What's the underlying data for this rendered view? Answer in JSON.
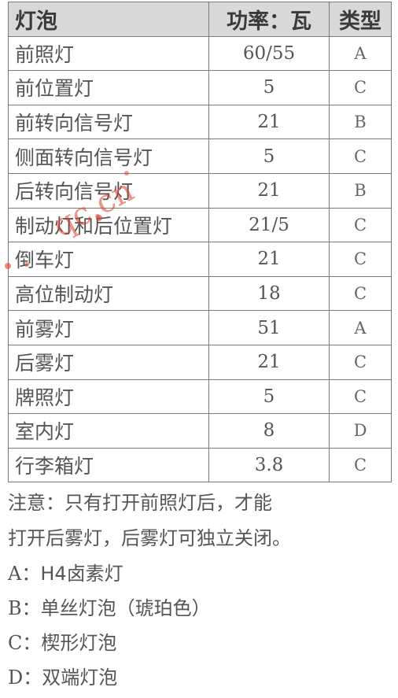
{
  "table": {
    "headers": {
      "name": "灯泡",
      "power": "功率：瓦",
      "type": "类型"
    },
    "rows": [
      {
        "name": "前照灯",
        "power": "60/55",
        "type": "A"
      },
      {
        "name": "前位置灯",
        "power": "5",
        "type": "C"
      },
      {
        "name": "前转向信号灯",
        "power": "21",
        "type": "B"
      },
      {
        "name": "侧面转向信号灯",
        "power": "5",
        "type": "C"
      },
      {
        "name": "后转向信号灯",
        "power": "21",
        "type": "B"
      },
      {
        "name": "制动灯和后位置灯",
        "power": "21/5",
        "type": "C"
      },
      {
        "name": "倒车灯",
        "power": "21",
        "type": "C"
      },
      {
        "name": "高位制动灯",
        "power": "18",
        "type": "C"
      },
      {
        "name": "前雾灯",
        "power": "51",
        "type": "A"
      },
      {
        "name": "后雾灯",
        "power": "21",
        "type": "C"
      },
      {
        "name": "牌照灯",
        "power": "5",
        "type": "C"
      },
      {
        "name": "室内灯",
        "power": "8",
        "type": "D"
      },
      {
        "name": "行李箱灯",
        "power": "3.8",
        "type": "C"
      }
    ]
  },
  "notes": {
    "line1": "注意：只有打开前照灯后，才能",
    "line2": "打开后雾灯，后雾灯可独立关闭。"
  },
  "legend": [
    {
      "key": "A：",
      "text": "H4卤素灯"
    },
    {
      "key": "B：",
      "text": "单丝灯泡（琥珀色）"
    },
    {
      "key": "C：",
      "text": "楔形灯泡"
    },
    {
      "key": "D：",
      "text": "双端灯泡"
    }
  ],
  "watermark": {
    "text": "qc.cn",
    "color": "#dc3c28"
  }
}
